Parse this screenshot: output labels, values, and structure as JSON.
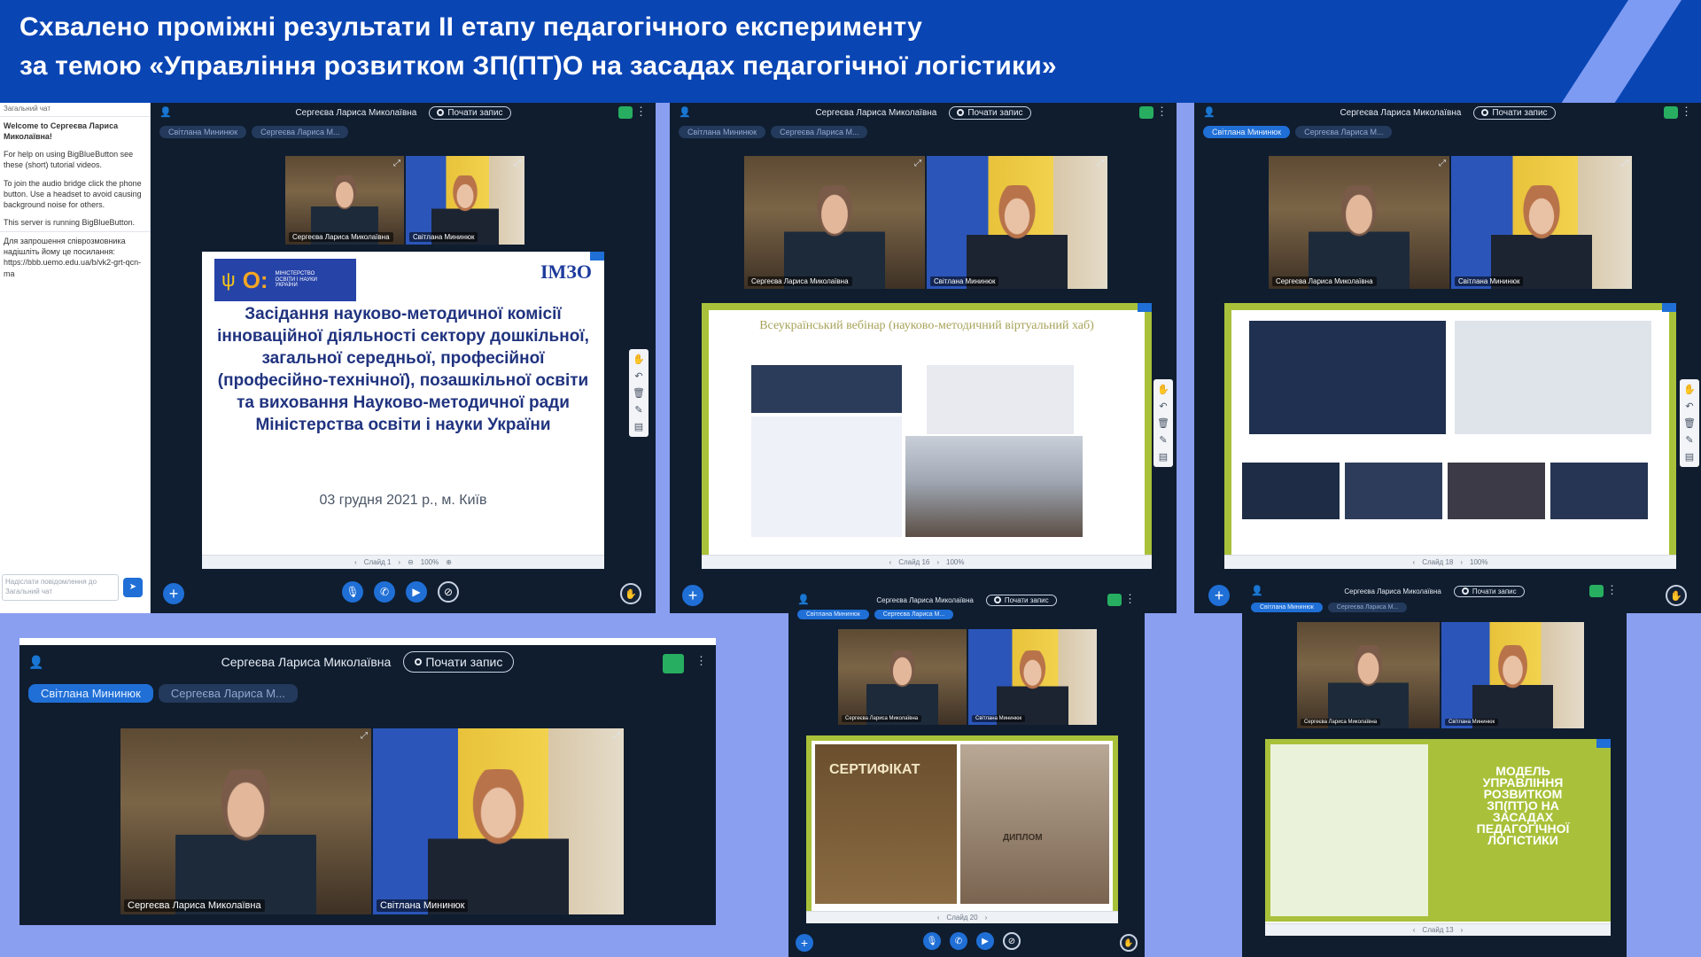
{
  "banner": {
    "line1": "Схвалено проміжні результати ІІ етапу педагогічного експерименту",
    "line2": "за темою «Управління розвитком ЗП(ПТ)О на засадах педагогічної логістики»"
  },
  "conference": {
    "presenter_name": "Сергеєва Лариса Миколаївна",
    "record_label": "Почати запис",
    "talker_1": "Світлана Мининюк",
    "talker_2": "Сергеєва Лариса М...",
    "cam_label_1": "Сергеєва Лариса Миколаївна",
    "cam_label_2": "Світлана Мининюк"
  },
  "chat": {
    "header": "Загальний чат",
    "welcome": "Welcome to Сергеєва Лариса Миколаївна!",
    "help": "For help on using BigBlueButton see these (short) tutorial videos.",
    "audio": "To join the audio bridge click the phone button. Use a headset to avoid causing background noise for others.",
    "server": "This server is running BigBlueButton.",
    "invite": "Для запрошення співрозмовника надішліть йому це посилання: https://bbb.uemo.edu.ua/b/vk2-grt-qcn-ma",
    "input_placeholder": "Надіслати повідомлення до Загальний чат"
  },
  "slides": {
    "s1": {
      "ministry": "МІНІСТЕРСТВО ОСВІТИ І НАУКИ УКРАЇНИ",
      "imzo": "ІМЗО",
      "body": "Засідання науково-методичної комісії інноваційної діяльності сектору дошкільної, загальної середньої, професійної (професійно-технічної), позашкільної освіти та виховання Науково-методичної ради Міністерства освіти і науки України",
      "date": "03 грудня 2021 р., м. Київ",
      "ctrl": "Слайд 1"
    },
    "s2": {
      "title": "Всеукраїнський вебінар (науково-методичний віртуальний хаб)",
      "ctrl": "Слайд 16"
    },
    "s3": {
      "ctrl": "Слайд 18"
    },
    "s5": {
      "cert": "СЕРТИФІКАТ",
      "diploma": "ДИПЛОМ",
      "ctrl": "Слайд 20"
    },
    "s6": {
      "model": "МОДЕЛЬ УПРАВЛІННЯ РОЗВИТКОМ ЗП(ПТ)О НА ЗАСАДАХ ПЕДАГОГІЧНОЇ ЛОГІСТИКИ",
      "ctrl": "Слайд 13"
    }
  },
  "zoom": "100%",
  "icons": [
    "user-icon",
    "record-icon",
    "connection-icon",
    "kebab-icon",
    "mic-icon",
    "phone-icon",
    "camera-icon",
    "screenshare-icon",
    "plus-icon",
    "hand-icon",
    "undo-icon",
    "trash-icon",
    "pencil-icon",
    "chart-icon",
    "send-icon"
  ],
  "colors": {
    "banner": "#0a45b4",
    "background": "#8a9ff0",
    "window": "#0f1d2f",
    "accent": "#1f6fd6",
    "slide_frame": "#a9c13a"
  }
}
